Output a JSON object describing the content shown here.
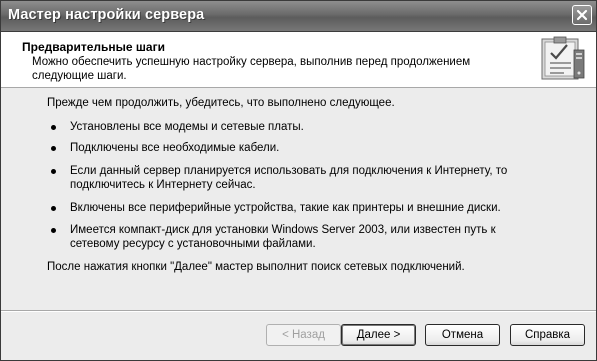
{
  "window": {
    "title": "Мастер настройки сервера"
  },
  "header": {
    "title": "Предварительные шаги",
    "subtitle": "Можно обеспечить успешную настройку сервера, выполнив перед продолжением следующие шаги.",
    "icon": "checklist-clipboard-icon"
  },
  "content": {
    "intro": "Прежде чем продолжить, убедитесь, что выполнено следующее.",
    "items": [
      {
        "text": "Установлены все модемы и сетевые платы."
      },
      {
        "text": "Подключены все необходимые кабели."
      },
      {
        "text": "Если данный сервер планируется использовать для подключения к Интернету, то подключитесь к Интернету сейчас."
      },
      {
        "text": "Включены все периферийные устройства, такие как принтеры и внешние диски."
      },
      {
        "text": "Имеется компакт-диск для установки Windows Server 2003, или известен путь к сетевому ресурсу с установочными файлами."
      }
    ],
    "footer_note": "После нажатия кнопки \"Далее\" мастер выполнит поиск сетевых подключений."
  },
  "buttons": {
    "back": "< Назад",
    "next": "Далее >",
    "cancel": "Отмена",
    "help": "Справка"
  }
}
